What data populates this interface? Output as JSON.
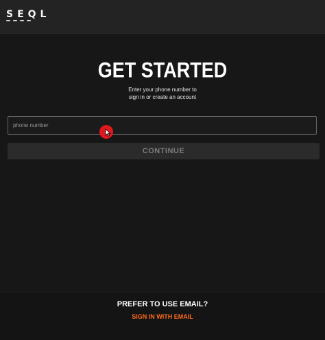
{
  "header": {
    "logo_text": "SEQL"
  },
  "main": {
    "title": "GET STARTED",
    "subtitle_line1": "Enter your phone number to",
    "subtitle_line2": "sign in or create an account",
    "phone_input": {
      "placeholder": "phone number",
      "value": ""
    },
    "continue_label": "CONTINUE"
  },
  "footer": {
    "question": "PREFER TO USE EMAIL?",
    "link_label": "SIGN IN WITH EMAIL"
  },
  "colors": {
    "background": "#171717",
    "header": "#232323",
    "accent": "#ff6a1a",
    "cursor": "#e0191f"
  }
}
